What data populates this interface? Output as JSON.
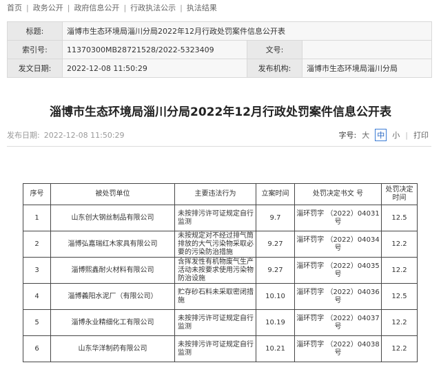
{
  "breadcrumb": [
    "首页",
    "政务公开",
    "政府信息公开",
    "行政执法公示",
    "执法结果"
  ],
  "meta": {
    "title_label": "标题:",
    "title_value": "淄博市生态环境局淄川分局2022年12月行政处罚案件信息公开表",
    "index_label": "索引号:",
    "index_value": "11370300MB28721528/2022-5323409",
    "docno_label": "文号:",
    "docno_value": "",
    "date_label": "发文日期:",
    "date_value": "2022-12-08 11:50:29",
    "org_label": "发布机构:",
    "org_value": "淄博市生态环境局淄川分局"
  },
  "article": {
    "title": "淄博市生态环境局淄川分局2022年12月行政处罚案件信息公开表",
    "pub_label": "发布日期:",
    "pub_date": "2022-12-08 11:50:29",
    "font_label": "字号:",
    "font_large": "大",
    "font_medium": "中",
    "font_small": "小",
    "print": "打印"
  },
  "table": {
    "headers": [
      "序号",
      "被处罚单位",
      "主要违法行为",
      "立案时间",
      "处罚决定书文 号",
      "处罚决定时间"
    ],
    "rows": [
      {
        "no": "1",
        "unit": "山东创大钢丝制品有限公司",
        "act": "未按排污许可证规定自行监测",
        "filed": "9.7",
        "doc": "淄环罚字 （2022）04031号",
        "time": "12.5"
      },
      {
        "no": "2",
        "unit": "淄博弘嘉瑞红木家具有限公司",
        "act": "未按规定对不经过排气筒排放的大气污染物采取必要的污染防治措施",
        "filed": "9.27",
        "doc": "淄环罚字 （2022）04034号",
        "time": "12.2"
      },
      {
        "no": "3",
        "unit": "淄博熙鑫耐火材料有限公司",
        "act": "含挥发性有机物废气生产活动未按要求使用污染物防治设施",
        "filed": "9.27",
        "doc": "淄环罚字 （2022）04035号",
        "time": "12.2"
      },
      {
        "no": "4",
        "unit": "淄博義阳水泥厂（有限公司）",
        "act": "贮存砂石料未采取密闭措施",
        "filed": "10.10",
        "doc": "淄环罚字 （2022）04036号",
        "time": "12.5"
      },
      {
        "no": "5",
        "unit": "淄博永业精细化工有限公司",
        "act": "未按排污许可证规定自行监测",
        "filed": "10.19",
        "doc": "淄环罚字 （2022）04037号",
        "time": "12.2"
      },
      {
        "no": "6",
        "unit": "山东华洋制药有限公司",
        "act": "未按排污许可证规定自行监测",
        "filed": "10.21",
        "doc": "淄环罚字 （2022）04038号",
        "time": "12.2"
      }
    ]
  }
}
